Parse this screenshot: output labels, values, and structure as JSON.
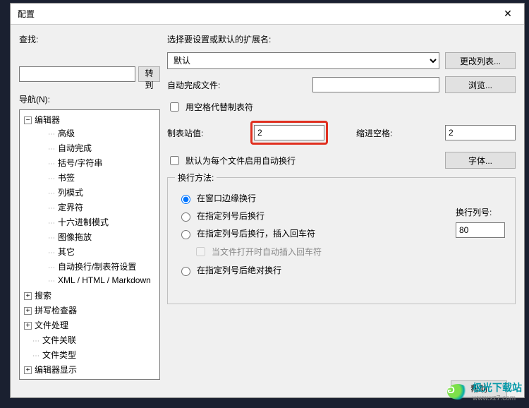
{
  "window": {
    "title": "配置",
    "close": "✕"
  },
  "left": {
    "search_label": "查找:",
    "goto_btn": "转到",
    "nav_label": "导航(N):",
    "tree": {
      "editor": {
        "label": "编辑器",
        "expanded": true,
        "children": [
          "高级",
          "自动完成",
          "括号/字符串",
          "书签",
          "列模式",
          "定界符",
          "十六进制模式",
          "图像拖放",
          "其它",
          "自动换行/制表符设置",
          "XML / HTML / Markdown"
        ]
      },
      "after": [
        {
          "label": "搜索",
          "expandable": true
        },
        {
          "label": "拼写检查器",
          "expandable": true
        },
        {
          "label": "文件处理",
          "expandable": true
        },
        {
          "label": "文件关联",
          "expandable": false
        },
        {
          "label": "文件类型",
          "expandable": false
        },
        {
          "label": "编辑器显示",
          "expandable": true
        }
      ]
    }
  },
  "right": {
    "ext_label": "选择要设置或默认的扩展名:",
    "ext_default": "默认",
    "change_list_btn": "更改列表...",
    "autocomplete_label": "自动完成文件:",
    "browse_btn": "浏览...",
    "use_spaces_cb": "用空格代替制表符",
    "tabstop_label": "制表站值:",
    "tabstop_value": "2",
    "indent_label": "缩进空格:",
    "indent_value": "2",
    "default_autowrap_cb": "默认为每个文件启用自动换行",
    "font_btn": "字体...",
    "group_legend": "换行方法:",
    "radios": {
      "r1": "在窗口边缘换行",
      "r2": "在指定列号后换行",
      "r3": "在指定列号后换行，插入回车符",
      "r3_sub": "当文件打开时自动插入回车符",
      "r4": "在指定列号后绝对换行"
    },
    "wrap_col_label": "换行列号:",
    "wrap_col_value": "80"
  },
  "footer": {
    "help_btn": "帮助"
  },
  "watermark": {
    "line1": "极光下载站",
    "line2": "www.xz7.com"
  }
}
